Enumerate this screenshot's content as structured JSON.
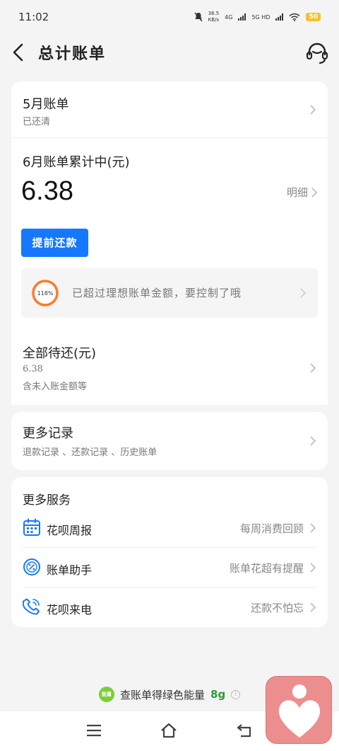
{
  "status_bar": {
    "time": "11:02",
    "speed_value": "38.5",
    "speed_unit": "KB/s",
    "net1": "4G",
    "net2": "5G HD",
    "battery": "50"
  },
  "header": {
    "title": "总计账单",
    "back_icon": "chevron-left-icon",
    "service_icon": "customer-service-icon"
  },
  "bill_card": {
    "may": {
      "title": "5月账单",
      "status": "已还清"
    },
    "june": {
      "title": "6月账单累计中(元)",
      "amount": "6.38",
      "detail_label": "明细",
      "prepay_button": "提前还款"
    },
    "tip": {
      "percent_label": "118%",
      "percent_value": 1.18,
      "text": "已超过理想账单金额，要控制了哦"
    },
    "all_due": {
      "title": "全部待还(元)",
      "amount": "6.38",
      "note": "含未入账金额等"
    }
  },
  "records_card": {
    "title": "更多记录",
    "subtitle": "退款记录 、还款记录 、历史账单"
  },
  "services_card": {
    "title": "更多服务",
    "items": [
      {
        "label": "花呗周报",
        "desc": "每周消费回顾",
        "icon": "calendar-icon"
      },
      {
        "label": "账单助手",
        "desc": "账单花超有提醒",
        "icon": "percent-badge-icon"
      },
      {
        "label": "花呗来电",
        "desc": "还款不怕忘",
        "icon": "phone-icon"
      }
    ]
  },
  "energy": {
    "badge": "能量",
    "text": "查账单得绿色能量",
    "value": "8g"
  },
  "colors": {
    "primary": "#1677ff",
    "gauge_ring": "#ff7a2e",
    "energy_green": "#2a9d3a",
    "floating_app": "#ec8e8e"
  }
}
